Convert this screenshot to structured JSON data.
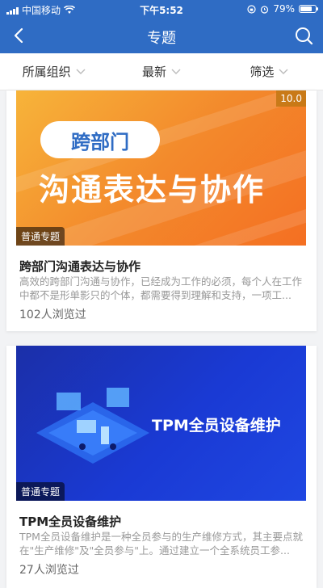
{
  "status_bar": {
    "carrier": "中国移动",
    "time": "下午5:52",
    "battery": "79%",
    "battery_level": 0.79
  },
  "nav": {
    "title": "专题",
    "back_icon": "back-arrow-icon",
    "search_icon": "search-icon"
  },
  "filters": [
    {
      "label": "所属组织"
    },
    {
      "label": "最新"
    },
    {
      "label": "筛选"
    }
  ],
  "cards": [
    {
      "image_tag": "跨部门",
      "image_title": "沟通表达与协作",
      "score": "10.0",
      "type": "普通专题",
      "title": "跨部门沟通表达与协作",
      "desc": "高效的跨部门沟通与协作，已经成为工作的必须，每个人在工作中都不是形单影只的个体，都需要得到理解和支持，一项工...",
      "views": "102人浏览过"
    },
    {
      "image_title": "TPM全员设备维护",
      "type": "普通专题",
      "title": "TPM全员设备维护",
      "desc": "TPM全员设备维护是一种全员参与的生产维修方式，其主要点就在\"生产维修\"及\"全员参与\"上。通过建立一个全系统员工参...",
      "views": "27人浏览过"
    }
  ]
}
